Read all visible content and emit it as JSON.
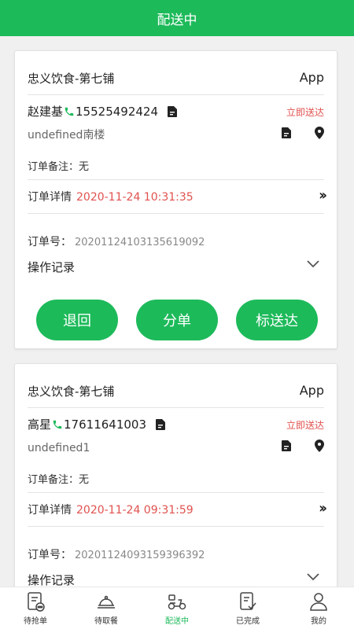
{
  "header": {
    "title": "配送中"
  },
  "orders": [
    {
      "shop": "忠义饮食-第七铺",
      "source": "App",
      "customer": "赵建基",
      "phone": "15525492424",
      "urgency": "立即送达",
      "address": "undefined南楼",
      "note_label": "订单备注：",
      "note": "无",
      "detail_label": "订单详情",
      "time": "2020-11-24 10:31:35",
      "order_no_label": "订单号：",
      "order_no": "20201124103135619092",
      "oplog_label": "操作记录",
      "buttons": {
        "return": "退回",
        "split": "分单",
        "mark": "标送达"
      }
    },
    {
      "shop": "忠义饮食-第七铺",
      "source": "App",
      "customer": "高星",
      "phone": "17611641003",
      "urgency": "立即送达",
      "address": "undefined1",
      "note_label": "订单备注：",
      "note": "无",
      "detail_label": "订单详情",
      "time": "2020-11-24 09:31:59",
      "order_no_label": "订单号：",
      "order_no": "20201124093159396392",
      "oplog_label": "操作记录"
    }
  ],
  "tabbar": [
    {
      "label": "待抢单",
      "icon": "clipboard-icon",
      "active": false
    },
    {
      "label": "待取餐",
      "icon": "food-cloche-icon",
      "active": false
    },
    {
      "label": "配送中",
      "icon": "scooter-icon",
      "active": true
    },
    {
      "label": "已完成",
      "icon": "checklist-icon",
      "active": false
    },
    {
      "label": "我的",
      "icon": "user-icon",
      "active": false
    }
  ],
  "colors": {
    "accent": "#1dba5a",
    "time": "#e0524f"
  }
}
